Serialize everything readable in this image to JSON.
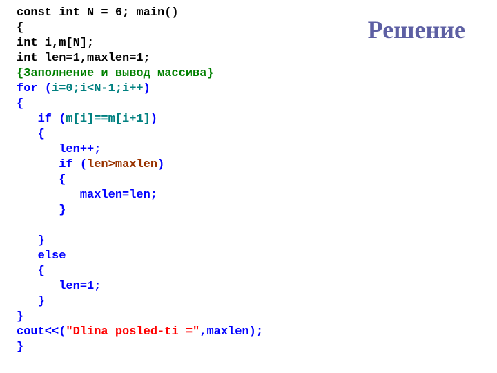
{
  "heading": "Решение",
  "code": {
    "l1": "const int N = 6; main()",
    "l2": "{",
    "l3": "int i,m[N];",
    "l4": "int len=1,maxlen=1;",
    "l5": "{Заполнение и вывод массива}",
    "l6a": "for (",
    "l6b": "i=0;i<N-1;i++",
    "l6c": ")",
    "l7": "{",
    "l8a": "   if (",
    "l8b": "m[i]==m[i+1]",
    "l8c": ")",
    "l9": "   {",
    "l10": "      len++;",
    "l11a": "      if (",
    "l11b": "len>maxlen",
    "l11c": ")",
    "l12": "      {",
    "l13": "         maxlen=len;",
    "l14": "      }",
    "l15": "",
    "l16": "   }",
    "l17": "   else",
    "l18": "   {",
    "l19": "      len=1;",
    "l20": "   }",
    "l21": "}",
    "l22a": "cout<<(",
    "l22b": "\"Dlina posled-ti =\"",
    "l22c": ",maxlen);",
    "l23": "}"
  }
}
